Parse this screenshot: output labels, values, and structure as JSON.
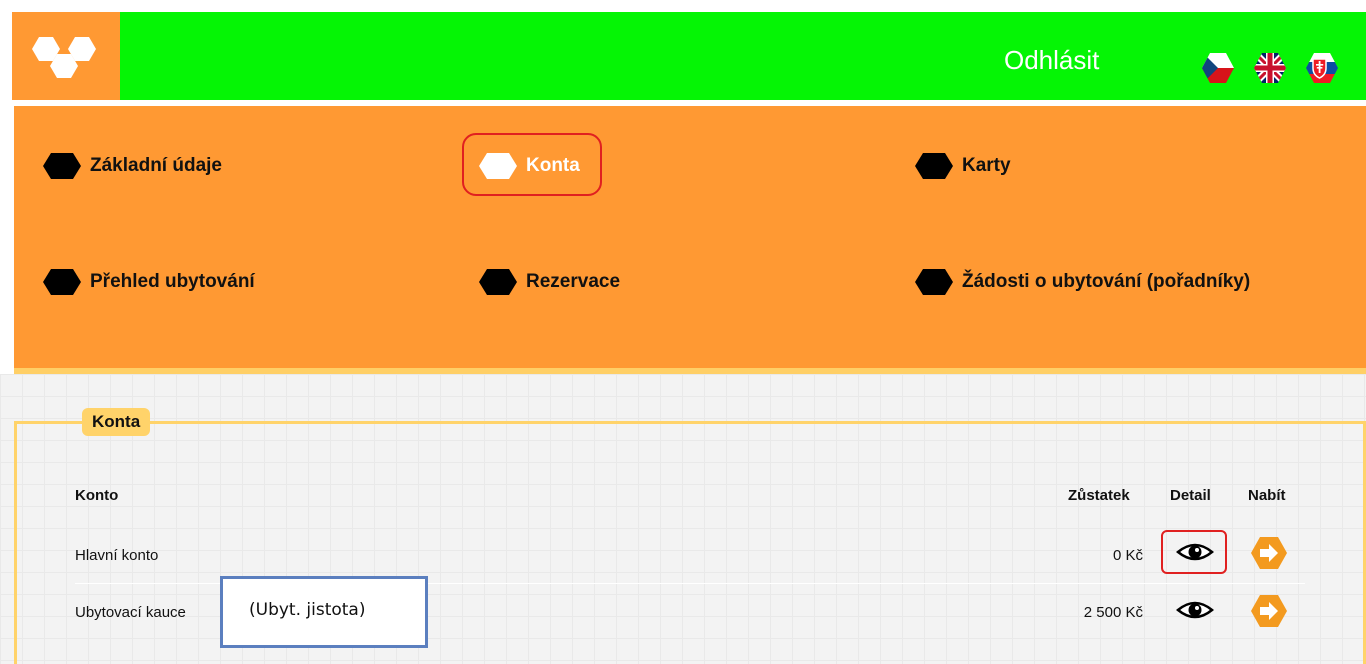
{
  "header": {
    "logout_label": "Odhlásit",
    "flags": [
      "czech-flag-icon",
      "uk-flag-icon",
      "slovak-flag-icon"
    ],
    "background_color": "#05f505",
    "logo_color": "#ff9933"
  },
  "nav": {
    "items": [
      {
        "label": "Základní údaje",
        "active": false
      },
      {
        "label": "Konta",
        "active": true
      },
      {
        "label": "Karty",
        "active": false
      },
      {
        "label": "Přehled ubytování",
        "active": false
      },
      {
        "label": "Rezervace",
        "active": false
      },
      {
        "label": "Žádosti o ubytování (pořadníky)",
        "active": false
      }
    ],
    "background_color": "#ff9933"
  },
  "accounts": {
    "legend": "Konta",
    "columns": {
      "account": "Konto",
      "balance": "Zůstatek",
      "detail": "Detail",
      "charge": "Nabít"
    },
    "rows": [
      {
        "name": "Hlavní konto",
        "balance": "0 Kč"
      },
      {
        "name": "Ubytovací kauce",
        "balance": "2 500 Kč"
      }
    ],
    "annotation": "(Ubyt. jistota)"
  }
}
